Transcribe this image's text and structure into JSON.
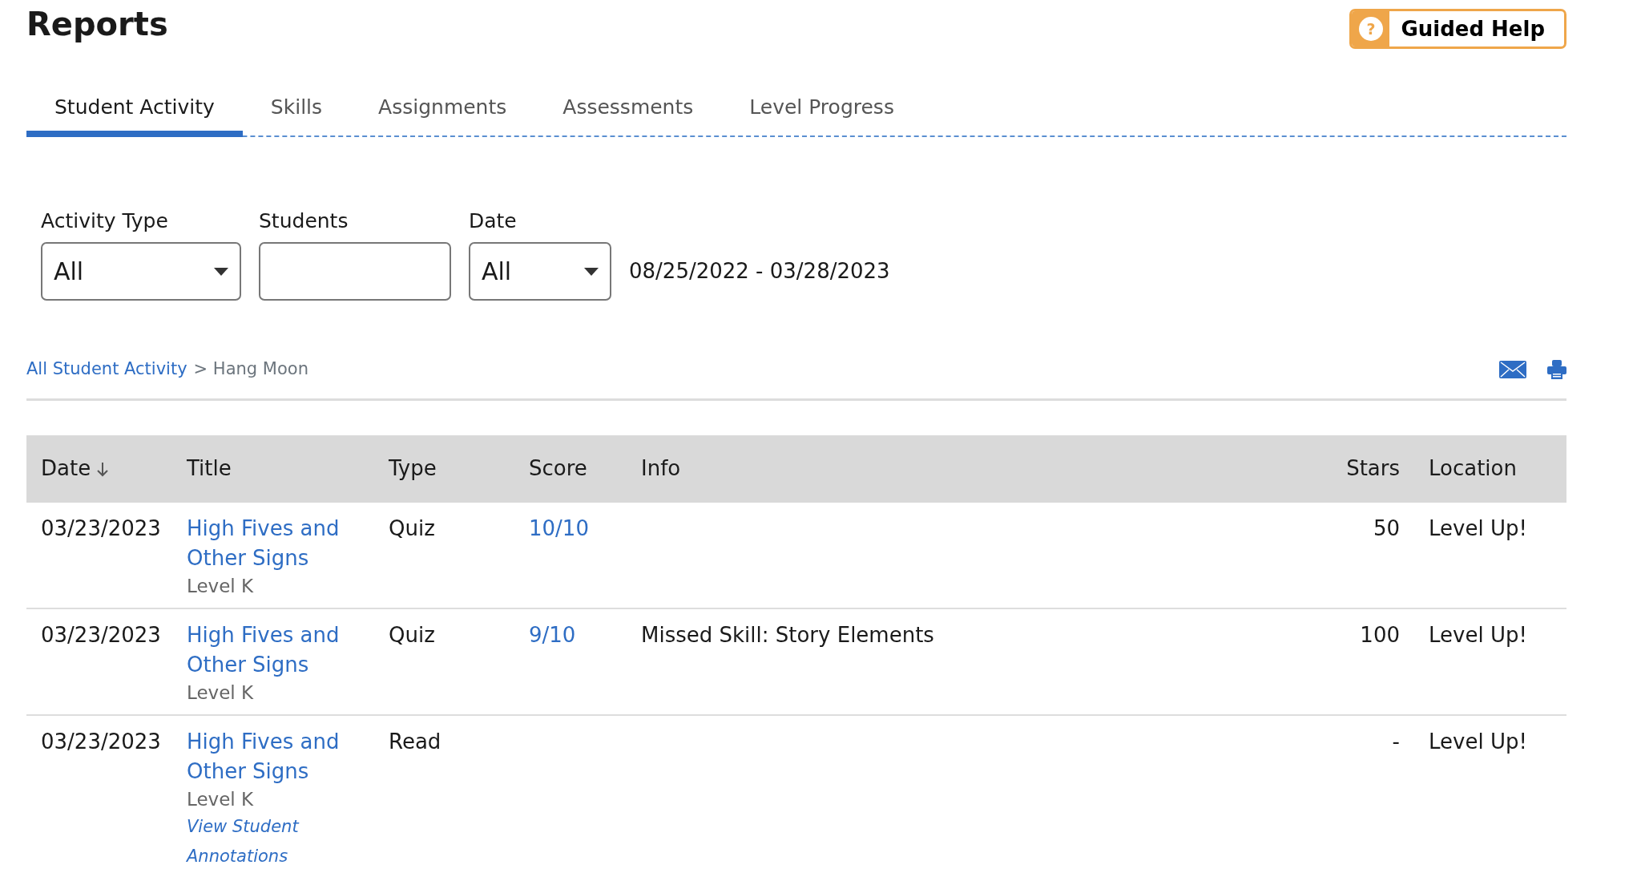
{
  "page_title": "Reports",
  "help_button": {
    "icon": "?",
    "label": "Guided Help"
  },
  "tabs": [
    {
      "label": "Student Activity",
      "selected": true
    },
    {
      "label": "Skills",
      "selected": false
    },
    {
      "label": "Assignments",
      "selected": false
    },
    {
      "label": "Assessments",
      "selected": false
    },
    {
      "label": "Level Progress",
      "selected": false
    }
  ],
  "filters": [
    {
      "kind": "select",
      "label": "Activity Type",
      "value": "All"
    },
    {
      "kind": "text",
      "label": "Students"
    },
    {
      "kind": "select",
      "label": "Date",
      "value": "All"
    }
  ],
  "date_range": "08/25/2022 - 03/28/2023",
  "breadcrumb": {
    "link": "All Student Activity",
    "separator": ">",
    "current": "Hang Moon"
  },
  "table": {
    "columns": [
      {
        "label": "Date",
        "sorted": true
      },
      {
        "label": "Title",
        "sorted": false
      },
      {
        "label": "Type",
        "sorted": false
      },
      {
        "label": "Score",
        "sorted": false
      },
      {
        "label": "Info",
        "sorted": false
      },
      {
        "label": "Stars",
        "sorted": false
      },
      {
        "label": "Location",
        "sorted": false
      }
    ],
    "rows": [
      {
        "date": "03/23/2023",
        "title": "High Fives and Other Signs",
        "level": "Level K",
        "type": "Quiz",
        "score": "10/10",
        "stars_earned": "50",
        "location": "Level Up!"
      },
      {
        "date": "03/23/2023",
        "title": "High Fives and Other Signs",
        "level": "Level K",
        "type": "Quiz",
        "score": "9/10",
        "info": "Missed Skill: Story Elements",
        "stars_earned": "100",
        "location": "Level Up!"
      },
      {
        "date": "03/23/2023",
        "title": "High Fives and Other Signs",
        "level": "Level K",
        "annotations_link": "View Student Annotations",
        "type": "Read",
        "stars_earned": "-",
        "location": "Level Up!"
      }
    ]
  }
}
